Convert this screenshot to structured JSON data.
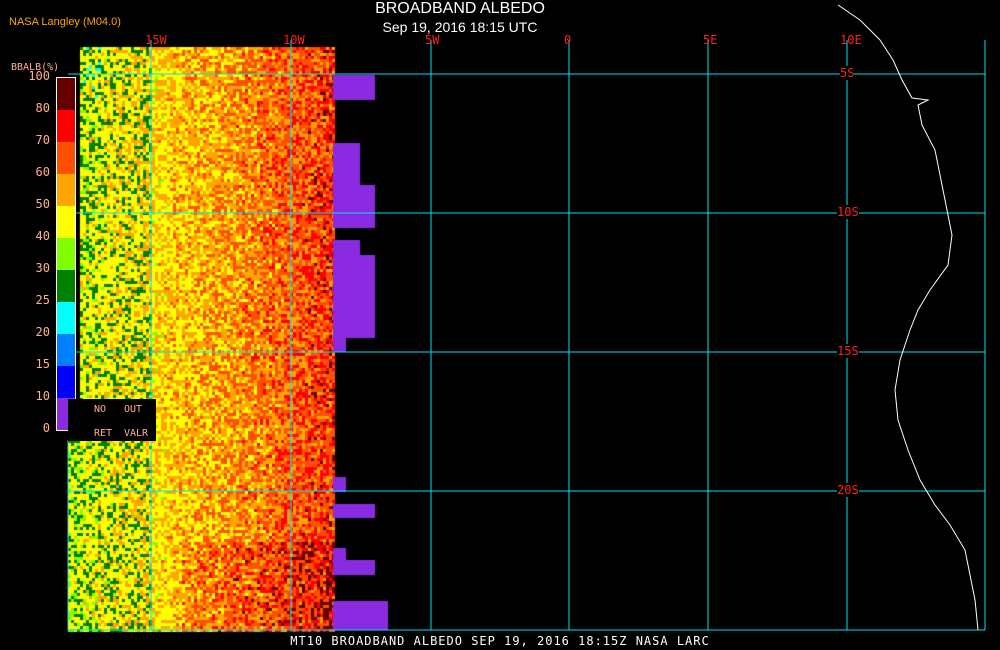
{
  "header": {
    "title": "BROADBAND ALBEDO",
    "subtitle": "Sep 19, 2016 18:15 UTC",
    "credit": "NASA Langley (M04.0)"
  },
  "grid": {
    "longitudes": [
      "15W",
      "10W",
      "5W",
      "0",
      "5E",
      "10E"
    ],
    "latitudes": [
      "5S",
      "10S",
      "15S",
      "20S"
    ]
  },
  "legend": {
    "title": "BBALB(%)",
    "ticks": [
      "0",
      "10",
      "15",
      "20",
      "25",
      "30",
      "40",
      "50",
      "60",
      "70",
      "80",
      "100"
    ],
    "colors": [
      "#8a2be2",
      "#0000ff",
      "#0080ff",
      "#00ffff",
      "#008000",
      "#80ff00",
      "#ffff00",
      "#ffa500",
      "#ff5000",
      "#ff0000",
      "#660000"
    ],
    "no_ret": [
      "NO",
      "RET"
    ],
    "out_valr": [
      "OUT",
      "VALR"
    ]
  },
  "footer": {
    "caption": "MT10  BROADBAND ALBEDO   SEP 19, 2016 18:15Z   NASA LARC"
  },
  "colors": {
    "grid": "#00e5ee",
    "labels": "#ff2020",
    "coast": "#ffffff",
    "nodata": "#8a2be2"
  }
}
